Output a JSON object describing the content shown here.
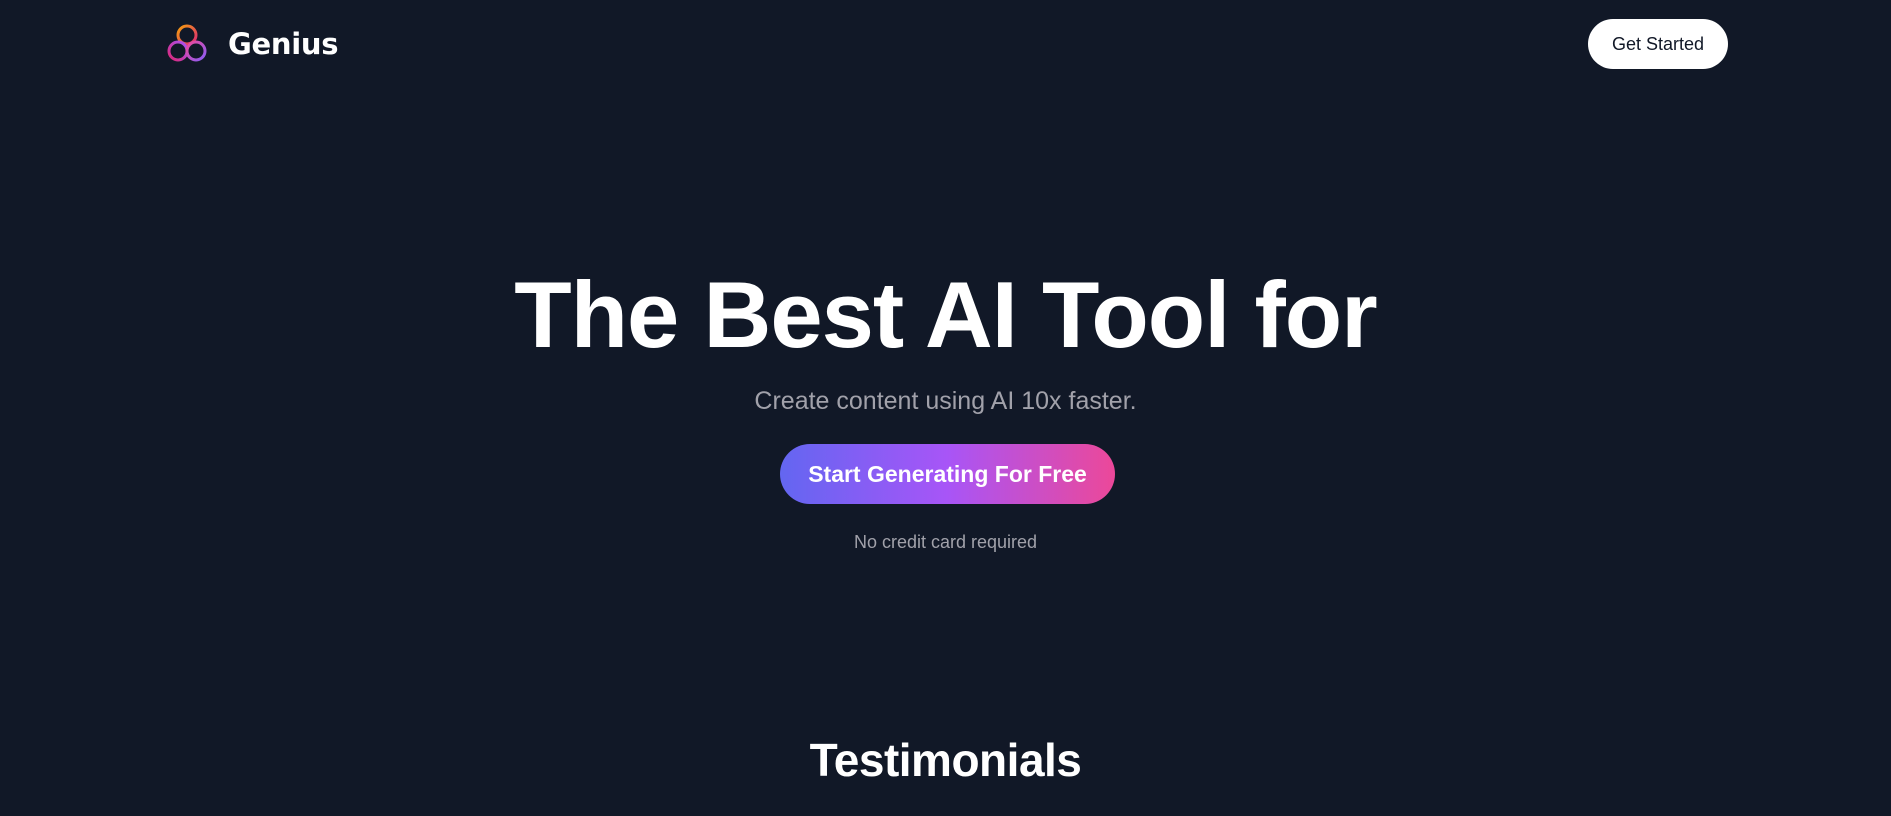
{
  "navbar": {
    "brand_name": "Genius",
    "logo_icon": "genius-knot-logo",
    "get_started_label": "Get Started"
  },
  "hero": {
    "title": "The Best AI Tool for",
    "subtitle": "Create content using AI 10x faster.",
    "cta_label": "Start Generating For Free",
    "note": "No credit card required"
  },
  "testimonials": {
    "heading": "Testimonials"
  },
  "colors": {
    "background": "#111827",
    "text_primary": "#ffffff",
    "text_muted": "#a1a1aa",
    "button_white": "#ffffff",
    "gradient_start": "#6366f1",
    "gradient_mid": "#a855f7",
    "gradient_end": "#ec4899",
    "logo_orange": "#f59e0b",
    "logo_pink": "#db2777"
  }
}
